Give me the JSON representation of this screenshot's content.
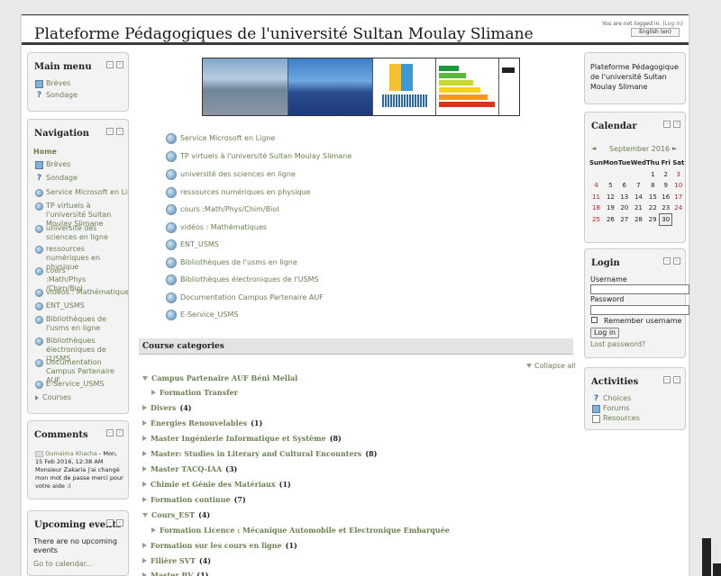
{
  "header": {
    "title": "Plateforme Pédagogiques de l'université Sultan Moulay Slimane",
    "login_prefix": "You are not logged in. (",
    "login_link": "Log in",
    "login_suffix": ")",
    "language": "English (en)"
  },
  "main_menu": {
    "title": "Main menu",
    "items": [
      {
        "label": "Brèves",
        "icon": "news-icon"
      },
      {
        "label": "Sondage",
        "icon": "question-icon"
      }
    ]
  },
  "navigation": {
    "title": "Navigation",
    "home": "Home",
    "items": [
      {
        "label": "Brèves"
      },
      {
        "label": "Sondage"
      },
      {
        "label": "Service Microsoft en Lig"
      },
      {
        "label": "TP virtuels à l'université Sultan Moulay Slimane"
      },
      {
        "label": "université des sciences en ligne"
      },
      {
        "label": "ressources numériques en physique"
      },
      {
        "label": "cours :Math/Phys /Chim/Biol"
      },
      {
        "label": "vidéos : Mathématiques"
      },
      {
        "label": "ENT_USMS"
      },
      {
        "label": "Bibliothèques de l'usms en ligne"
      },
      {
        "label": "Bibliothèques électroniques de l'USMS"
      },
      {
        "label": "Documentation Campus Partenaire AUF"
      },
      {
        "label": "E-Service_USMS"
      },
      {
        "label": "Courses"
      }
    ]
  },
  "comments": {
    "title": "Comments",
    "author": "Oumaima Khacha",
    "meta": " - Mon, 15 Feb 2016, 12:38 AM",
    "text": "Monsieur Zakaria j'ai changé mon mot de passe merci pour votre aide :)"
  },
  "upcoming": {
    "title": "Upcoming events",
    "none": "There are no upcoming events",
    "goto": "Go to calendar..."
  },
  "center_links": [
    "Service Microsoft en Ligne",
    "TP virtuels à l'université Sultan Moulay Slimane",
    "université des sciences en ligne",
    "ressources numériques en physique",
    "cours :Math/Phys/Chim/Biol",
    "vidéos : Mathématiques",
    "ENT_USMS",
    "Bibliothèques de l'usms en ligne",
    "Bibliothèques électroniques de l'USMS",
    "Documentation Campus Partenaire AUF",
    "E-Service_USMS"
  ],
  "course_categories": {
    "title": "Course categories",
    "collapse_all": "Collapse all",
    "items": [
      {
        "name": "Campus Partenaire AUF Béni Mellal",
        "count": "",
        "expanded": true
      },
      {
        "name": "Formation Transfer",
        "count": "",
        "sub": true
      },
      {
        "name": "Divers",
        "count": "(4)"
      },
      {
        "name": "Énergies Renouvelables",
        "count": "(1)"
      },
      {
        "name": "Master Ingénierie Informatique et Système",
        "count": "(8)"
      },
      {
        "name": "Master: Studies in Literary and Cultural Encounters",
        "count": "(8)"
      },
      {
        "name": "Master TACQ-IAA",
        "count": "(3)"
      },
      {
        "name": "Chimie et Génie des Matériaux",
        "count": "(1)"
      },
      {
        "name": "Formation continue",
        "count": "(7)"
      },
      {
        "name": "Cours_EST",
        "count": "(4)",
        "expanded": true
      },
      {
        "name": "Formation Licence : Mécanique Automobile et Electronique Embarquée",
        "count": "",
        "sub": true
      },
      {
        "name": "Formation sur les cours en ligne",
        "count": "(1)"
      },
      {
        "name": "Filière SVT",
        "count": "(4)"
      },
      {
        "name": "Master BV",
        "count": "(1)"
      }
    ]
  },
  "site_block": {
    "text": "Plateforme Pédagogique de l'université Sultan Moulay Slimane"
  },
  "calendar": {
    "title": "Calendar",
    "month": "September 2016",
    "days": [
      "Sun",
      "Mon",
      "Tue",
      "Wed",
      "Thu",
      "Fri",
      "Sat"
    ],
    "weeks": [
      [
        "",
        "",
        "",
        "",
        "1",
        "2",
        "3"
      ],
      [
        "4",
        "5",
        "6",
        "7",
        "8",
        "9",
        "10"
      ],
      [
        "11",
        "12",
        "13",
        "14",
        "15",
        "16",
        "17"
      ],
      [
        "18",
        "19",
        "20",
        "21",
        "22",
        "23",
        "24"
      ],
      [
        "25",
        "26",
        "27",
        "28",
        "29",
        "30",
        ""
      ]
    ]
  },
  "login": {
    "title": "Login",
    "username_label": "Username",
    "password_label": "Password",
    "remember": "Remember username",
    "button": "Log in",
    "lost": "Lost password?"
  },
  "activities": {
    "title": "Activities",
    "items": [
      "Choices",
      "Forums",
      "Resources"
    ]
  },
  "colors": {
    "link": "#6b7f50",
    "weekend": "#b22222"
  }
}
